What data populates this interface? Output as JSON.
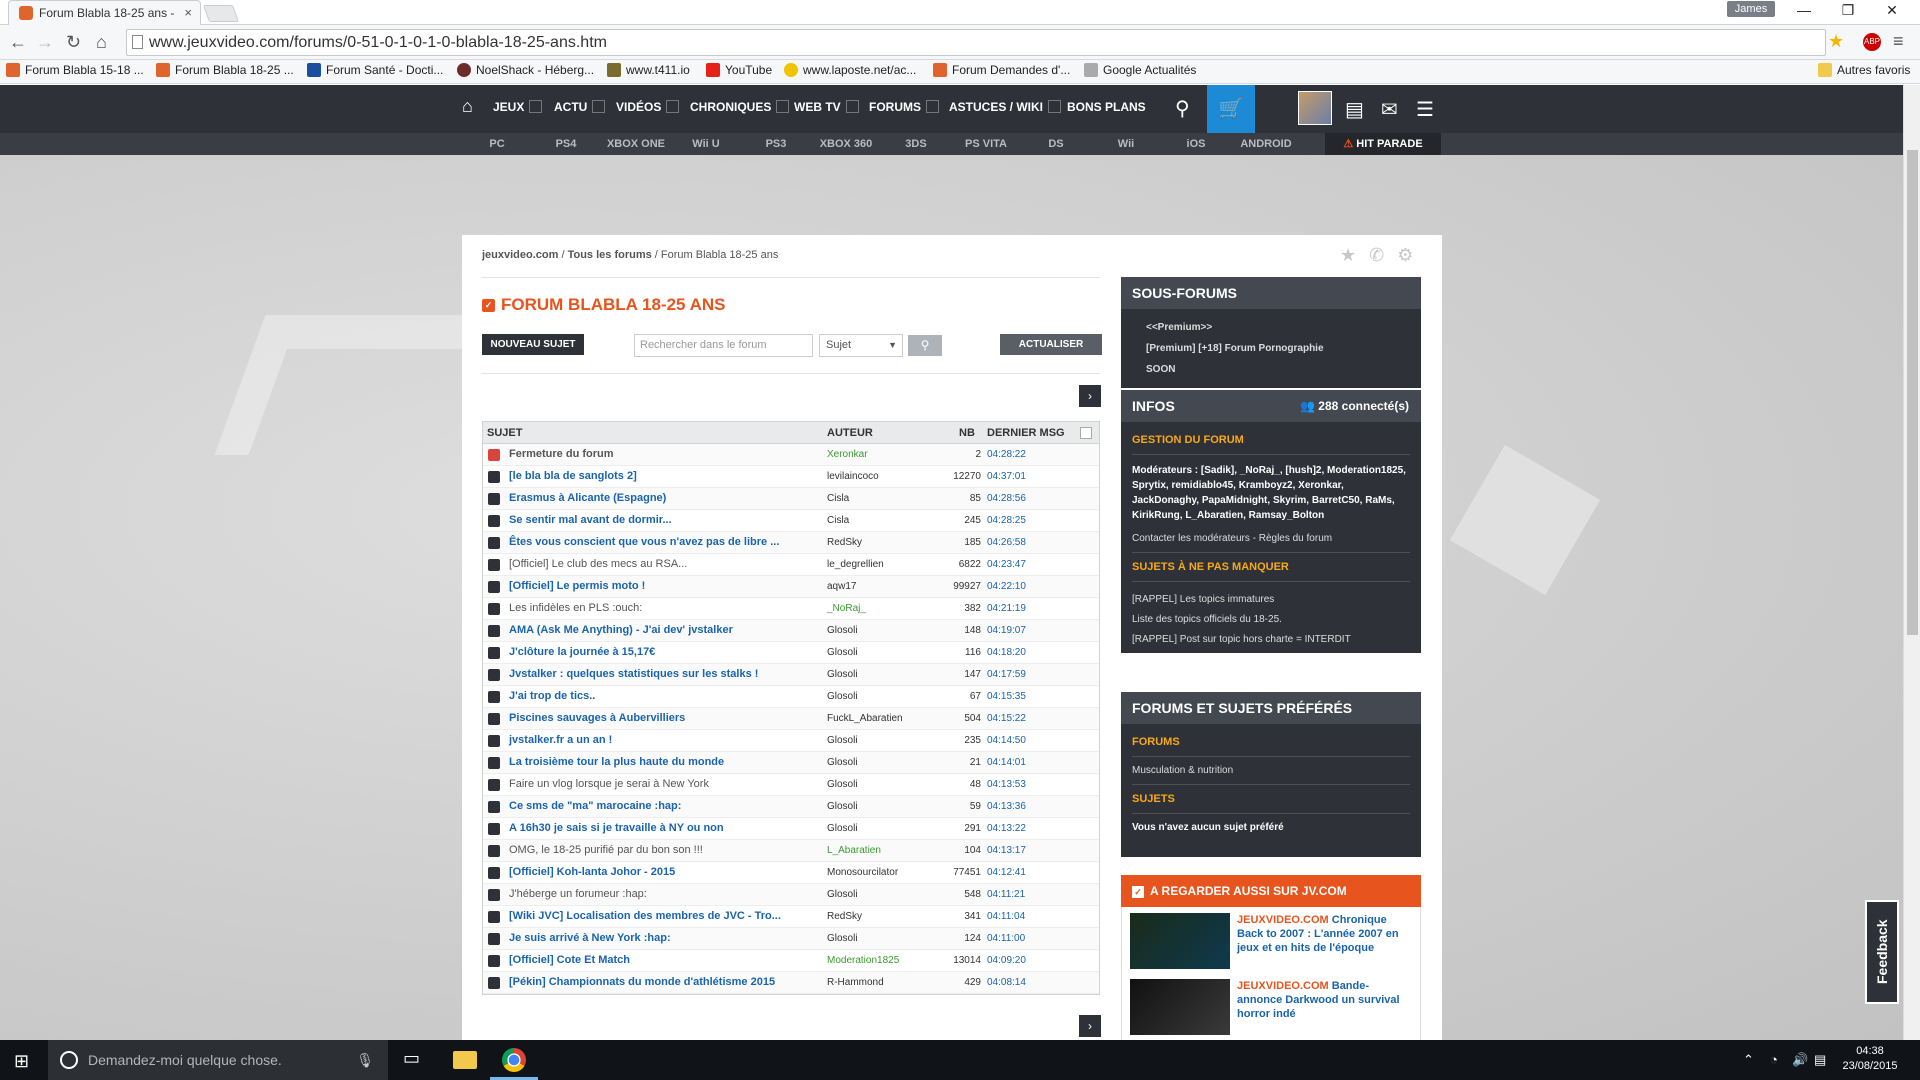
{
  "browser": {
    "tab_title": "Forum Blabla 18-25 ans -",
    "tab_close": "×",
    "user": "James",
    "url": "www.jeuxvideo.com/forums/0-51-0-1-0-1-0-blabla-18-25-ans.htm",
    "bookmarks": [
      "Forum Blabla 15-18 ...",
      "Forum Blabla 18-25 ...",
      "Forum Santé - Docti...",
      "NoelShack - Héberg...",
      "www.t411.io",
      "YouTube",
      "www.laposte.net/ac...",
      "Forum Demandes d'...",
      "Google Actualités"
    ],
    "other_bookmarks": "Autres favoris"
  },
  "sitenav": {
    "items": [
      "JEUX",
      "ACTU",
      "VIDÉOS",
      "CHRONIQUES",
      "WEB TV",
      "FORUMS",
      "ASTUCES / WIKI",
      "BONS PLANS"
    ],
    "platforms": [
      "PC",
      "PS4",
      "XBOX ONE",
      "Wii U",
      "PS3",
      "XBOX 360",
      "3DS",
      "PS VITA",
      "DS",
      "Wii",
      "iOS",
      "ANDROID"
    ],
    "hit_parade": "HIT PARADE"
  },
  "breadcrumb": [
    "jeuxvideo.com",
    "Tous les forums",
    "Forum Blabla 18-25 ans"
  ],
  "forum": {
    "title": "FORUM BLABLA 18-25 ANS",
    "new_topic": "NOUVEAU SUJET",
    "search_placeholder": "Rechercher dans le forum",
    "search_scope": "Sujet",
    "refresh": "ACTUALISER"
  },
  "table": {
    "headers": {
      "subject": "SUJET",
      "author": "AUTEUR",
      "count": "NB",
      "last": "DERNIER MSG"
    },
    "rows": [
      {
        "subject": "Fermeture du forum",
        "author": "Xeronkar",
        "nb": "2",
        "last": "04:28:22",
        "style": "graybold",
        "icon": "pin",
        "author_color": "green"
      },
      {
        "subject": "[le bla bla de sanglots 2]",
        "author": "levilaincoco",
        "nb": "12270",
        "last": "04:37:01",
        "style": "link",
        "icon": "lock",
        "author_color": "normal"
      },
      {
        "subject": "Erasmus à Alicante (Espagne)",
        "author": "Cisla",
        "nb": "85",
        "last": "04:28:56",
        "style": "link",
        "icon": "lock",
        "author_color": "normal"
      },
      {
        "subject": "Se sentir mal avant de dormir...",
        "author": "Cisla",
        "nb": "245",
        "last": "04:28:25",
        "style": "link",
        "icon": "lock",
        "author_color": "normal"
      },
      {
        "subject": "Êtes vous conscient que vous n'avez pas de libre ...",
        "author": "RedSky",
        "nb": "185",
        "last": "04:26:58",
        "style": "link",
        "icon": "lock",
        "author_color": "normal"
      },
      {
        "subject": "[Officiel] Le club des mecs au RSA...",
        "author": "le_degrellien",
        "nb": "6822",
        "last": "04:23:47",
        "style": "gray",
        "icon": "lock",
        "author_color": "normal"
      },
      {
        "subject": "[Officiel] Le permis moto !",
        "author": "aqw17",
        "nb": "99927",
        "last": "04:22:10",
        "style": "link",
        "icon": "lock",
        "author_color": "normal"
      },
      {
        "subject": "Les infidèles en PLS :ouch:",
        "author": "_NoRaj_",
        "nb": "382",
        "last": "04:21:19",
        "style": "gray",
        "icon": "lock",
        "author_color": "green"
      },
      {
        "subject": "AMA (Ask Me Anything) - J'ai dev' jvstalker",
        "author": "Glosoli",
        "nb": "148",
        "last": "04:19:07",
        "style": "link",
        "icon": "lock",
        "author_color": "normal"
      },
      {
        "subject": "J'clôture la journée à 15,17€",
        "author": "Glosoli",
        "nb": "116",
        "last": "04:18:20",
        "style": "link",
        "icon": "lock",
        "author_color": "normal"
      },
      {
        "subject": "Jvstalker : quelques statistiques sur les stalks !",
        "author": "Glosoli",
        "nb": "147",
        "last": "04:17:59",
        "style": "link",
        "icon": "lock",
        "author_color": "normal"
      },
      {
        "subject": "J'ai trop de tics..",
        "author": "Glosoli",
        "nb": "67",
        "last": "04:15:35",
        "style": "link",
        "icon": "lock",
        "author_color": "normal"
      },
      {
        "subject": "Piscines sauvages à Aubervilliers",
        "author": "FuckL_Abaratien",
        "nb": "504",
        "last": "04:15:22",
        "style": "link",
        "icon": "lock",
        "author_color": "normal"
      },
      {
        "subject": "jvstalker.fr a un an !",
        "author": "Glosoli",
        "nb": "235",
        "last": "04:14:50",
        "style": "link",
        "icon": "lock",
        "author_color": "normal"
      },
      {
        "subject": "La troisième tour la plus haute du monde",
        "author": "Glosoli",
        "nb": "21",
        "last": "04:14:01",
        "style": "link",
        "icon": "lock",
        "author_color": "normal"
      },
      {
        "subject": "Faire un vlog lorsque je serai à New York",
        "author": "Glosoli",
        "nb": "48",
        "last": "04:13:53",
        "style": "gray",
        "icon": "lock",
        "author_color": "normal"
      },
      {
        "subject": "Ce sms de \"ma\" marocaine :hap:",
        "author": "Glosoli",
        "nb": "59",
        "last": "04:13:36",
        "style": "link",
        "icon": "lock",
        "author_color": "normal"
      },
      {
        "subject": "A 16h30 je sais si je travaille à NY ou non",
        "author": "Glosoli",
        "nb": "291",
        "last": "04:13:22",
        "style": "link",
        "icon": "lock",
        "author_color": "normal"
      },
      {
        "subject": "OMG, le 18-25 purifié par du bon son !!!",
        "author": "L_Abaratien",
        "nb": "104",
        "last": "04:13:17",
        "style": "gray",
        "icon": "lock",
        "author_color": "green"
      },
      {
        "subject": "[Officiel] Koh-lanta Johor - 2015",
        "author": "Monosourcilator",
        "nb": "77451",
        "last": "04:12:41",
        "style": "link",
        "icon": "lock",
        "author_color": "normal"
      },
      {
        "subject": "J'héberge un forumeur :hap:",
        "author": "Glosoli",
        "nb": "548",
        "last": "04:11:21",
        "style": "gray",
        "icon": "lock",
        "author_color": "normal"
      },
      {
        "subject": "[Wiki JVC] Localisation des membres de JVC - Tro...",
        "author": "RedSky",
        "nb": "341",
        "last": "04:11:04",
        "style": "link",
        "icon": "lock",
        "author_color": "normal"
      },
      {
        "subject": "Je suis arrivé à New York :hap:",
        "author": "Glosoli",
        "nb": "124",
        "last": "04:11:00",
        "style": "link",
        "icon": "lock",
        "author_color": "normal"
      },
      {
        "subject": "[Officiel] Cote Et Match",
        "author": "Moderation1825",
        "nb": "13014",
        "last": "04:09:20",
        "style": "link",
        "icon": "lock",
        "author_color": "green"
      },
      {
        "subject": "[Pékin] Championnats du monde d'athlétisme 2015",
        "author": "R-Hammond",
        "nb": "429",
        "last": "04:08:14",
        "style": "link",
        "icon": "lock",
        "author_color": "normal"
      }
    ]
  },
  "sidebar": {
    "sous_forums": {
      "title": "SOUS-FORUMS",
      "items": [
        "<<Premium>>",
        "[Premium] [+18] Forum Pornographie",
        "SOON"
      ]
    },
    "infos": {
      "title": "INFOS",
      "connected": "288 connecté(s)",
      "gestion": "GESTION DU FORUM",
      "moderators": "Modérateurs : [Sadik], _NoRaj_, [hush]2, Moderation1825, Sprytix, remidiablo45, Kramboyz2, Xeronkar, JackDonaghy, PapaMidnight, Skyrim, BarretC50, RaMs, KirikRung, L_Abaratien, Ramsay_Bolton",
      "contact": "Contacter les modérateurs - Règles du forum",
      "not_miss": "SUJETS À NE PAS MANQUER",
      "links": [
        "[RAPPEL] Les topics immatures",
        "Liste des topics officiels du 18-25.",
        "[RAPPEL] Post sur topic hors charte = INTERDIT"
      ]
    },
    "favorites": {
      "title": "FORUMS ET SUJETS PRÉFÉRÉS",
      "forums_label": "FORUMS",
      "forums_item": "Musculation & nutrition",
      "subjects_label": "SUJETS",
      "subjects_empty": "Vous n'avez aucun sujet préféré"
    },
    "watch": {
      "title": "A REGARDER AUSSI SUR JV.COM",
      "videos": [
        {
          "src": "JEUXVIDEO.COM",
          "title": "Chronique Back to 2007 : L'année 2007 en jeux et en hits de l'époque"
        },
        {
          "src": "JEUXVIDEO.COM",
          "title": "Bande-annonce Darkwood un survival horror indé"
        }
      ]
    }
  },
  "feedback": "Feedback",
  "taskbar": {
    "search_placeholder": "Demandez-moi quelque chose.",
    "time": "04:38",
    "date": "23/08/2015"
  }
}
